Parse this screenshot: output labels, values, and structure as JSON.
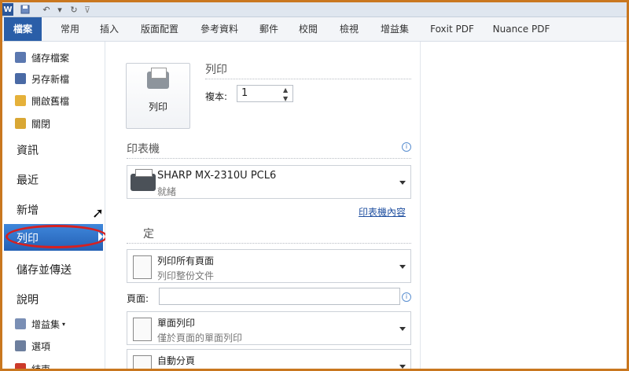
{
  "titlebar": {
    "logo": "W",
    "save_icon": "save-icon",
    "undo_icon": "undo-icon",
    "redo_icon": "redo-icon"
  },
  "tabs": [
    "檔案",
    "常用",
    "插入",
    "版面配置",
    "參考資料",
    "郵件",
    "校閱",
    "檢視",
    "增益集",
    "Foxit PDF",
    "Nuance PDF"
  ],
  "nav": {
    "small_top": [
      {
        "label": "儲存檔案",
        "icon": "save-icon",
        "color": "#5b78b0"
      },
      {
        "label": "另存新檔",
        "icon": "save-as-icon",
        "color": "#4a6aa5"
      },
      {
        "label": "開啟舊檔",
        "icon": "folder-open-icon",
        "color": "#e5b13a"
      },
      {
        "label": "關閉",
        "icon": "folder-close-icon",
        "color": "#d9a734"
      }
    ],
    "big": [
      "資訊",
      "最近",
      "新增"
    ],
    "active": "列印",
    "big_after": [
      "儲存並傳送",
      "說明"
    ],
    "small_bottom": [
      {
        "label": "增益集",
        "icon": "addin-icon",
        "color": "#7a8fb5",
        "has_arrow": true
      },
      {
        "label": "選項",
        "icon": "options-icon",
        "color": "#6d7f9e"
      },
      {
        "label": "結束",
        "icon": "exit-icon",
        "color": "#cc3a2a"
      }
    ]
  },
  "badge": "1",
  "print": {
    "button_label": "列印",
    "section_title": "列印",
    "copies_label": "複本:",
    "copies_value": "1"
  },
  "printer": {
    "section_title": "印表機",
    "name": "SHARP MX-2310U PCL6",
    "status": "就緒",
    "properties_link": "印表機內容"
  },
  "settings": {
    "section_title_partial": "定",
    "range_title": "列印所有頁面",
    "range_sub": "列印整份文件",
    "pages_label": "頁面:",
    "pages_value": "",
    "sides_title": "單面列印",
    "sides_sub": "僅於頁面的單面列印",
    "collate_title": "自動分頁"
  }
}
